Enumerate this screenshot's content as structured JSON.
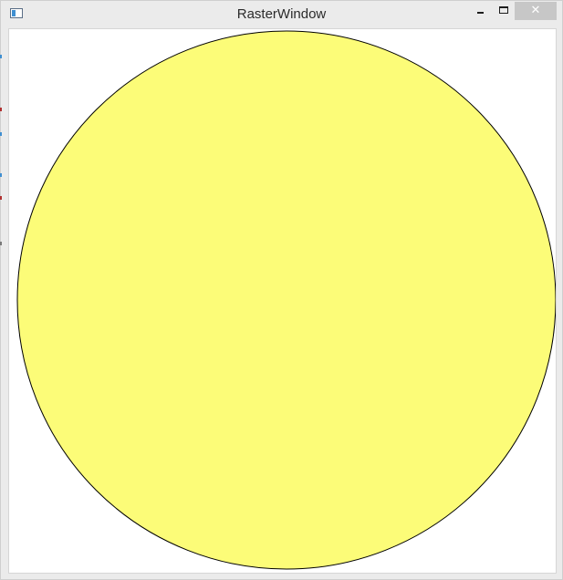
{
  "window": {
    "title": "RasterWindow"
  },
  "titlebar": {
    "app_icon": "window-app-icon",
    "buttons": [
      {
        "name": "minimize",
        "icon": "minimize-icon"
      },
      {
        "name": "maximize",
        "icon": "maximize-icon"
      },
      {
        "name": "close",
        "icon": "close-icon",
        "glyph": "✕"
      }
    ]
  },
  "canvas": {
    "shape": "circle",
    "fill_color": "#fcfc78",
    "stroke_color": "#000000"
  }
}
